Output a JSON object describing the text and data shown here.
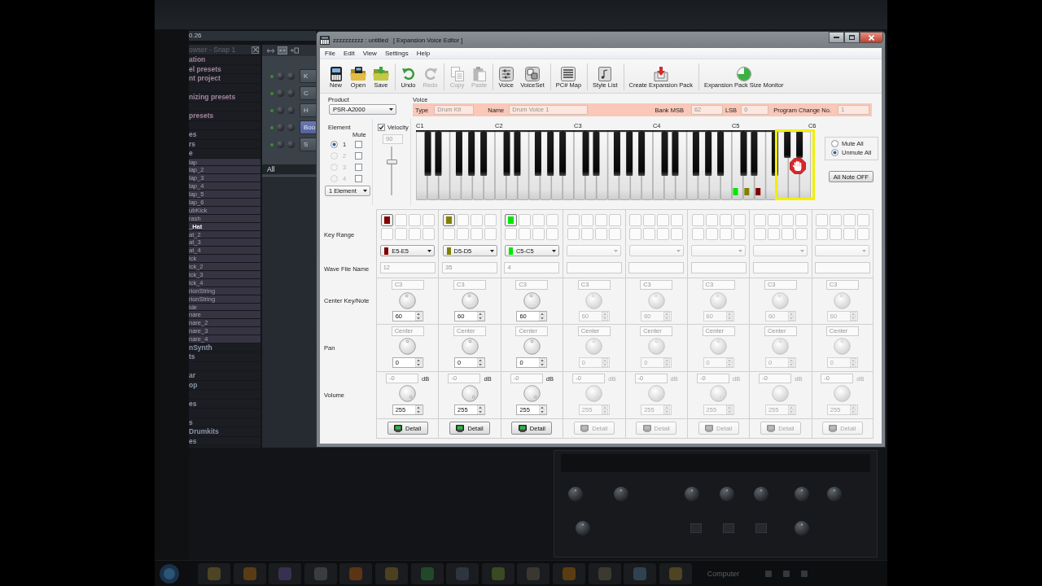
{
  "background": {
    "hint": "0.26",
    "browser": {
      "title": "owser - Snap 1",
      "items": [
        {
          "label": "ation",
          "kind": "folder",
          "selected": false
        },
        {
          "label": "el presets",
          "kind": "folder",
          "selected": false
        },
        {
          "label": "nt project",
          "kind": "folder",
          "selected": false
        },
        {
          "kind": "blank"
        },
        {
          "label": "nizing presets",
          "kind": "folder",
          "selected": false
        },
        {
          "kind": "blank"
        },
        {
          "label": "presets",
          "kind": "folder",
          "selected": false
        },
        {
          "kind": "blank"
        },
        {
          "label": "es",
          "kind": "group",
          "selected": false
        },
        {
          "label": "rs",
          "kind": "group",
          "selected": false
        },
        {
          "label": "e",
          "kind": "group",
          "selected": false
        },
        {
          "label": "lap",
          "kind": "file",
          "selected": false
        },
        {
          "label": "lap_2",
          "kind": "file",
          "selected": false
        },
        {
          "label": "lap_3",
          "kind": "file",
          "selected": false
        },
        {
          "label": "lap_4",
          "kind": "file",
          "selected": false
        },
        {
          "label": "lap_5",
          "kind": "file",
          "selected": false
        },
        {
          "label": "lap_6",
          "kind": "file",
          "selected": false
        },
        {
          "label": "ubKick",
          "kind": "file",
          "selected": false
        },
        {
          "label": "rash",
          "kind": "file",
          "selected": false
        },
        {
          "label": "_Hat",
          "kind": "file",
          "selected": true
        },
        {
          "label": "at_2",
          "kind": "file",
          "selected": false
        },
        {
          "label": "at_3",
          "kind": "file",
          "selected": false
        },
        {
          "label": "at_4",
          "kind": "file",
          "selected": false
        },
        {
          "label": "ick",
          "kind": "file",
          "selected": false
        },
        {
          "label": "ick_2",
          "kind": "file",
          "selected": false
        },
        {
          "label": "ick_3",
          "kind": "file",
          "selected": false
        },
        {
          "label": "ick_4",
          "kind": "file",
          "selected": false
        },
        {
          "label": "rionString",
          "kind": "file",
          "selected": false
        },
        {
          "label": "rionString",
          "kind": "file",
          "selected": false
        },
        {
          "label": "ide",
          "kind": "file",
          "selected": false
        },
        {
          "label": "nare",
          "kind": "file",
          "selected": false
        },
        {
          "label": "nare_2",
          "kind": "file",
          "selected": false
        },
        {
          "label": "nare_3",
          "kind": "file",
          "selected": false
        },
        {
          "label": "nare_4",
          "kind": "file",
          "selected": false
        },
        {
          "label": "nSynth",
          "kind": "group",
          "selected": false
        },
        {
          "label": "ts",
          "kind": "group",
          "selected": false
        },
        {
          "kind": "blank"
        },
        {
          "label": "ar",
          "kind": "group",
          "selected": false
        },
        {
          "label": "op",
          "kind": "group",
          "selected": false
        },
        {
          "kind": "blank"
        },
        {
          "label": "es",
          "kind": "group",
          "selected": false
        },
        {
          "kind": "blank"
        },
        {
          "label": "s",
          "kind": "group",
          "selected": false
        },
        {
          "label": "Drumkits",
          "kind": "group",
          "selected": false
        },
        {
          "label": "es",
          "kind": "group",
          "selected": false
        }
      ]
    },
    "rack": {
      "channels": [
        {
          "label": "K",
          "selected": false
        },
        {
          "label": "C",
          "selected": false
        },
        {
          "label": "H",
          "selected": false
        },
        {
          "label": "Boo",
          "selected": true
        },
        {
          "label": "S",
          "selected": false
        }
      ],
      "filter": "All"
    },
    "taskbar": {
      "label": "Computer"
    }
  },
  "window": {
    "title": "zzzzzzzzzz : untitled",
    "subtitle": "[ Expansion Voice Editor ]"
  },
  "menu": [
    {
      "label": "File"
    },
    {
      "label": "Edit"
    },
    {
      "label": "View"
    },
    {
      "label": "Settings"
    },
    {
      "label": "Help"
    }
  ],
  "toolbar": [
    [
      {
        "kind": "new",
        "label": "New",
        "disabled": false
      },
      {
        "kind": "open",
        "label": "Open",
        "disabled": false
      },
      {
        "kind": "save",
        "label": "Save",
        "disabled": false
      }
    ],
    [
      {
        "kind": "undo",
        "label": "Undo",
        "disabled": false
      },
      {
        "kind": "redo",
        "label": "Redo",
        "disabled": true
      }
    ],
    [
      {
        "kind": "copy",
        "label": "Copy",
        "disabled": true
      },
      {
        "kind": "paste",
        "label": "Paste",
        "disabled": true
      }
    ],
    [
      {
        "kind": "voice",
        "label": "Voice",
        "disabled": false
      },
      {
        "kind": "voiceset",
        "label": "VoiceSet",
        "disabled": false
      }
    ],
    [
      {
        "kind": "pcmap",
        "label": "PC# Map",
        "disabled": false
      }
    ],
    [
      {
        "kind": "stylelist",
        "label": "Style List",
        "disabled": false
      }
    ],
    [
      {
        "kind": "create",
        "label": "Create Expansion Pack",
        "disabled": false
      }
    ],
    [
      {
        "kind": "monitor",
        "label": "Expansion Pack Size Monitor",
        "disabled": false
      }
    ]
  ],
  "product": {
    "label": "Product",
    "value": "PSR-A2000"
  },
  "voice": {
    "label": "Voice",
    "fields": [
      {
        "label": "Type",
        "value": "Drum Kit"
      },
      {
        "label": "Name",
        "value": "Drum Voice 1"
      },
      {
        "label": "Bank MSB",
        "value": "62"
      },
      {
        "label": "LSB",
        "value": "0"
      },
      {
        "label": "Program Change No.",
        "value": "1"
      }
    ]
  },
  "element_panel": {
    "label": "Element",
    "mute_label": "Mute",
    "items": [
      {
        "number": "1",
        "selected": true,
        "disabled": false,
        "muted": false
      },
      {
        "number": "2",
        "selected": false,
        "disabled": true,
        "muted": false
      },
      {
        "number": "3",
        "selected": false,
        "disabled": true,
        "muted": false
      },
      {
        "number": "4",
        "selected": false,
        "disabled": true,
        "muted": false
      }
    ],
    "count": "1 Element"
  },
  "velocity": {
    "label": "Velocity",
    "checked": true,
    "value": "90",
    "level": 0.71
  },
  "keyboard": {
    "octaves": [
      {
        "label": "C1"
      },
      {
        "label": "C2"
      },
      {
        "label": "C3"
      },
      {
        "label": "C4"
      },
      {
        "label": "C5",
        "marks": [
          {
            "color": "#00e600"
          },
          {
            "color": "#808000"
          },
          {
            "color": "#800000"
          }
        ]
      }
    ],
    "end_label": "C6"
  },
  "mute_options": [
    {
      "label": "Mute All",
      "selected": false
    },
    {
      "label": "Unmute All",
      "selected": true
    }
  ],
  "all_note_off": {
    "label": "All Note OFF"
  },
  "grid": {
    "row_labels": [
      "Key Range",
      "Wave File Name",
      "Center Key/Note",
      "Pan",
      "Volume"
    ],
    "columns": [
      {
        "disabled": false,
        "color": "#800000",
        "key_range": "E5-E5",
        "wave_file": "12",
        "center": {
          "note": "C3",
          "value": "60"
        },
        "pan": {
          "position": "Center",
          "value": "0"
        },
        "volume": {
          "db": "-0",
          "unit": "dB",
          "value": "255"
        },
        "detail": "Detail"
      },
      {
        "disabled": false,
        "color": "#808000",
        "key_range": "D5-D5",
        "wave_file": "35",
        "center": {
          "note": "C3",
          "value": "60"
        },
        "pan": {
          "position": "Center",
          "value": "0"
        },
        "volume": {
          "db": "-0",
          "unit": "dB",
          "value": "255"
        },
        "detail": "Detail"
      },
      {
        "disabled": false,
        "color": "#00e600",
        "key_range": "C5-C5",
        "wave_file": "4",
        "center": {
          "note": "C3",
          "value": "60"
        },
        "pan": {
          "position": "Center",
          "value": "0"
        },
        "volume": {
          "db": "-0",
          "unit": "dB",
          "value": "255"
        },
        "detail": "Detail"
      },
      {
        "disabled": true,
        "center": {
          "note": "C3",
          "value": "60"
        },
        "pan": {
          "position": "Center",
          "value": "0"
        },
        "volume": {
          "db": "-0",
          "unit": "dB",
          "value": "255"
        },
        "detail": "Detail"
      },
      {
        "disabled": true,
        "center": {
          "note": "C3",
          "value": "60"
        },
        "pan": {
          "position": "Center",
          "value": "0"
        },
        "volume": {
          "db": "-0",
          "unit": "dB",
          "value": "255"
        },
        "detail": "Detail"
      },
      {
        "disabled": true,
        "center": {
          "note": "C3",
          "value": "60"
        },
        "pan": {
          "position": "Center",
          "value": "0"
        },
        "volume": {
          "db": "-0",
          "unit": "dB",
          "value": "255"
        },
        "detail": "Detail"
      },
      {
        "disabled": true,
        "center": {
          "note": "C3",
          "value": "60"
        },
        "pan": {
          "position": "Center",
          "value": "0"
        },
        "volume": {
          "db": "-0",
          "unit": "dB",
          "value": "255"
        },
        "detail": "Detail"
      },
      {
        "disabled": true,
        "center": {
          "note": "C3",
          "value": "60"
        },
        "pan": {
          "position": "Center",
          "value": "0"
        },
        "volume": {
          "db": "-0",
          "unit": "dB",
          "value": "255"
        },
        "detail": "Detail"
      }
    ]
  }
}
